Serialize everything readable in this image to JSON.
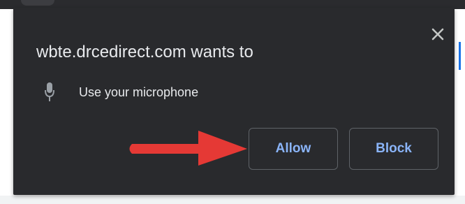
{
  "permission_prompt": {
    "title": "wbte.drcedirect.com wants to",
    "permission": {
      "icon": "microphone-icon",
      "label": "Use your microphone"
    },
    "allow_label": "Allow",
    "block_label": "Block",
    "close_icon": "close-icon"
  },
  "annotation": {
    "arrow_color": "#e53935",
    "arrow_target": "Allow"
  },
  "colors": {
    "dialog_background": "#292a2d",
    "text": "#e8eaed",
    "button_text": "#8ab4f8",
    "button_border": "#5f6368"
  }
}
